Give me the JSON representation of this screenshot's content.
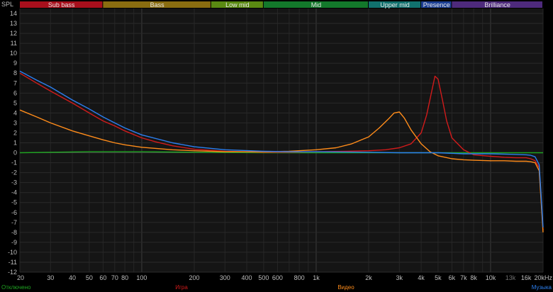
{
  "chart_data": {
    "type": "line",
    "ylabel": "SPL",
    "xscale": "log",
    "xlim": [
      20,
      20000
    ],
    "ylim": [
      -12,
      14.5
    ],
    "grid": true,
    "yticks": [
      14,
      13,
      12,
      11,
      10,
      9,
      8,
      7,
      6,
      5,
      4,
      3,
      2,
      1,
      0,
      -1,
      -2,
      -3,
      -4,
      -5,
      -6,
      -7,
      -8,
      -9,
      -10,
      -11,
      -12
    ],
    "xticks": [
      {
        "v": 20,
        "label": "20"
      },
      {
        "v": 30,
        "label": "30"
      },
      {
        "v": 40,
        "label": "40"
      },
      {
        "v": 50,
        "label": "50"
      },
      {
        "v": 60,
        "label": "60"
      },
      {
        "v": 70,
        "label": "70"
      },
      {
        "v": 80,
        "label": "80"
      },
      {
        "v": 100,
        "label": "100"
      },
      {
        "v": 200,
        "label": "200"
      },
      {
        "v": 300,
        "label": "300"
      },
      {
        "v": 400,
        "label": "400"
      },
      {
        "v": 500,
        "label": "500"
      },
      {
        "v": 600,
        "label": "600"
      },
      {
        "v": 800,
        "label": "800"
      },
      {
        "v": 1000,
        "label": "1k"
      },
      {
        "v": 2000,
        "label": "2k"
      },
      {
        "v": 3000,
        "label": "3k"
      },
      {
        "v": 4000,
        "label": "4k"
      },
      {
        "v": 5000,
        "label": "5k"
      },
      {
        "v": 6000,
        "label": "6k"
      },
      {
        "v": 7000,
        "label": "7k"
      },
      {
        "v": 8000,
        "label": "8k"
      },
      {
        "v": 10000,
        "label": "10k"
      },
      {
        "v": 13000,
        "label": "13k",
        "dim": true
      },
      {
        "v": 16000,
        "label": "16k"
      },
      {
        "v": 20000,
        "label": "20kHz"
      }
    ],
    "bands": [
      {
        "label": "Sub bass",
        "from": 20,
        "to": 60,
        "color": "#a80f1c"
      },
      {
        "label": "Bass",
        "from": 60,
        "to": 250,
        "color": "#8a6d10"
      },
      {
        "label": "Low mid",
        "from": 250,
        "to": 500,
        "color": "#5a8a12"
      },
      {
        "label": "Mid",
        "from": 500,
        "to": 2000,
        "color": "#13792b"
      },
      {
        "label": "Upper mid",
        "from": 2000,
        "to": 4000,
        "color": "#11716e"
      },
      {
        "label": "Presence",
        "from": 4000,
        "to": 6000,
        "color": "#1c3f94"
      },
      {
        "label": "Brilliance",
        "from": 6000,
        "to": 20000,
        "color": "#4e2a7c"
      }
    ],
    "series": [
      {
        "name": "Отключено",
        "color": "#1fa321",
        "x": [
          20,
          50,
          100,
          200,
          500,
          1000,
          2000,
          5000,
          10000,
          15000,
          18000,
          20000
        ],
        "y": [
          0,
          0.1,
          0.1,
          0.05,
          0,
          0,
          0,
          0,
          0,
          0,
          0,
          0
        ]
      },
      {
        "name": "Игра",
        "color": "#d11b1b",
        "x": [
          20,
          25,
          30,
          40,
          50,
          60,
          70,
          80,
          100,
          120,
          150,
          200,
          300,
          500,
          700,
          1000,
          1500,
          2000,
          2500,
          3000,
          3500,
          4000,
          4300,
          4600,
          4800,
          5000,
          5300,
          5600,
          6000,
          7000,
          8000,
          10000,
          12000,
          14000,
          16000,
          17000,
          18000,
          19000,
          20000
        ],
        "y": [
          8,
          7,
          6.2,
          5.0,
          4.0,
          3.2,
          2.7,
          2.2,
          1.5,
          1.1,
          0.7,
          0.35,
          0.15,
          0.05,
          0.05,
          0.1,
          0.15,
          0.2,
          0.3,
          0.5,
          0.9,
          2.0,
          3.8,
          6.2,
          7.7,
          7.4,
          5.3,
          3.2,
          1.5,
          0.3,
          -0.2,
          -0.35,
          -0.45,
          -0.5,
          -0.5,
          -0.6,
          -0.8,
          -1.5,
          -7.8
        ]
      },
      {
        "name": "Видео",
        "color": "#ff8c1a",
        "x": [
          20,
          25,
          30,
          40,
          50,
          60,
          70,
          80,
          100,
          150,
          200,
          300,
          500,
          700,
          1000,
          1300,
          1600,
          2000,
          2300,
          2600,
          2800,
          3000,
          3200,
          3500,
          4000,
          4500,
          5000,
          6000,
          7000,
          8000,
          10000,
          12000,
          14000,
          16000,
          17000,
          18000,
          19000,
          20000
        ],
        "y": [
          4.3,
          3.6,
          3.0,
          2.2,
          1.7,
          1.3,
          1.0,
          0.8,
          0.55,
          0.3,
          0.2,
          0.1,
          0.1,
          0.15,
          0.3,
          0.5,
          0.9,
          1.6,
          2.5,
          3.4,
          4.0,
          4.1,
          3.5,
          2.3,
          0.9,
          0.1,
          -0.3,
          -0.6,
          -0.7,
          -0.75,
          -0.8,
          -0.8,
          -0.85,
          -0.85,
          -0.9,
          -1.0,
          -1.8,
          -8.0
        ]
      },
      {
        "name": "Музыка",
        "color": "#2c7ff0",
        "x": [
          20,
          25,
          30,
          40,
          50,
          60,
          70,
          80,
          100,
          150,
          200,
          300,
          500,
          700,
          1000,
          2000,
          3000,
          5000,
          7000,
          10000,
          13000,
          16000,
          17000,
          18000,
          19000,
          20000
        ],
        "y": [
          8.2,
          7.3,
          6.6,
          5.3,
          4.4,
          3.6,
          3.0,
          2.5,
          1.8,
          1.0,
          0.6,
          0.3,
          0.15,
          0.1,
          0.1,
          0.05,
          0.0,
          0.0,
          -0.1,
          -0.1,
          -0.15,
          -0.2,
          -0.25,
          -0.4,
          -1.2,
          -7.5
        ]
      }
    ]
  }
}
